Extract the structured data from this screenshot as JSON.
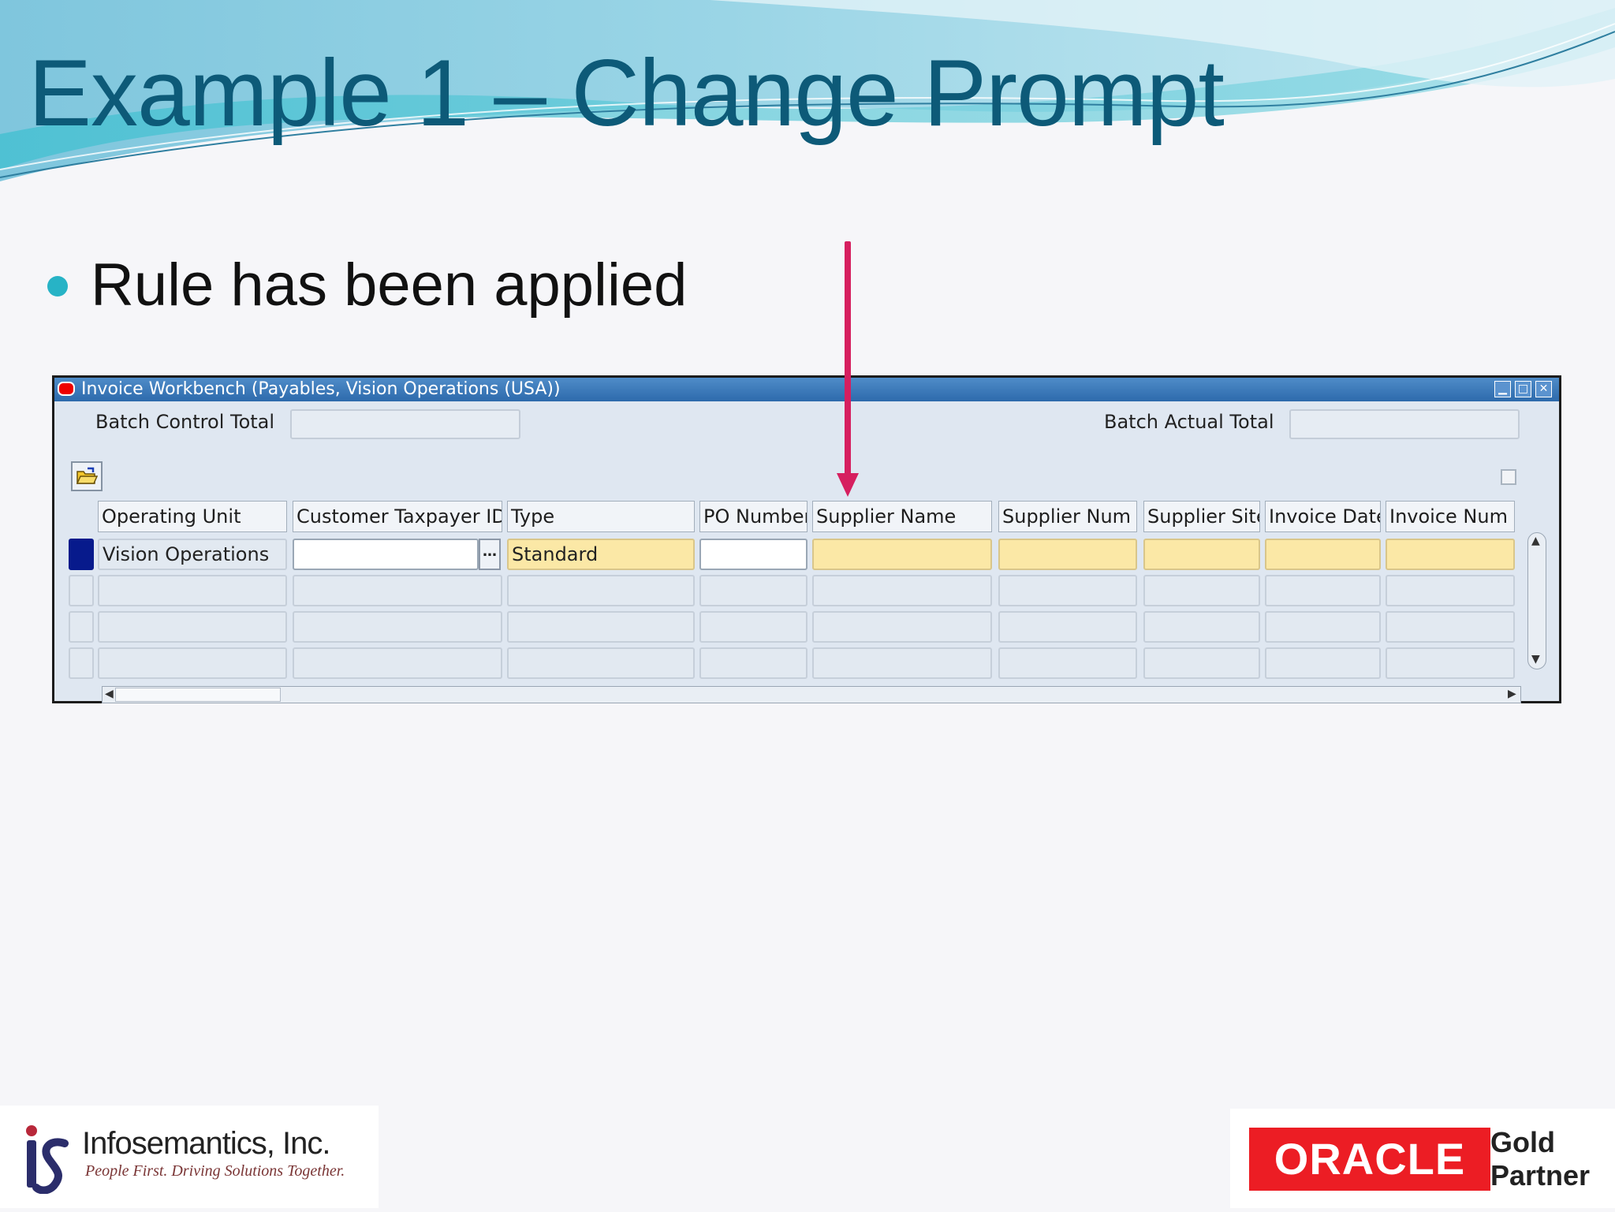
{
  "slide": {
    "title": "Example 1 – Change Prompt",
    "bullet": "Rule has been applied"
  },
  "window": {
    "title": "Invoice Workbench (Payables, Vision Operations (USA))",
    "batch_control_total_label": "Batch Control Total",
    "batch_control_total_value": "",
    "batch_actual_total_label": "Batch Actual Total",
    "batch_actual_total_value": "",
    "columns": [
      "Operating Unit",
      "Customer Taxpayer ID",
      "Type",
      "PO Number",
      "Supplier Name",
      "Supplier Num",
      "Supplier Site",
      "Invoice Date",
      "Invoice Num"
    ],
    "rows": [
      [
        "Vision Operations",
        "",
        "Standard",
        "",
        "",
        "",
        "",
        "",
        ""
      ],
      [
        "",
        "",
        "",
        "",
        "",
        "",
        "",
        "",
        ""
      ],
      [
        "",
        "",
        "",
        "",
        "",
        "",
        "",
        "",
        ""
      ],
      [
        "",
        "",
        "",
        "",
        "",
        "",
        "",
        "",
        ""
      ]
    ],
    "lov_button": "…"
  },
  "logos": {
    "infosemantics_name": "Infosemantics, Inc.",
    "infosemantics_tagline": "People First. Driving Solutions Together.",
    "oracle": "ORACLE",
    "partner_line1": "Gold",
    "partner_line2": "Partner"
  },
  "colors": {
    "title": "#0d5a78",
    "bullet": "#27b3c6",
    "titlebar": "#2d6aac",
    "required_field": "#fbe8a6",
    "callout_arrow": "#d61f5f",
    "oracle_red": "#ec1d24"
  }
}
